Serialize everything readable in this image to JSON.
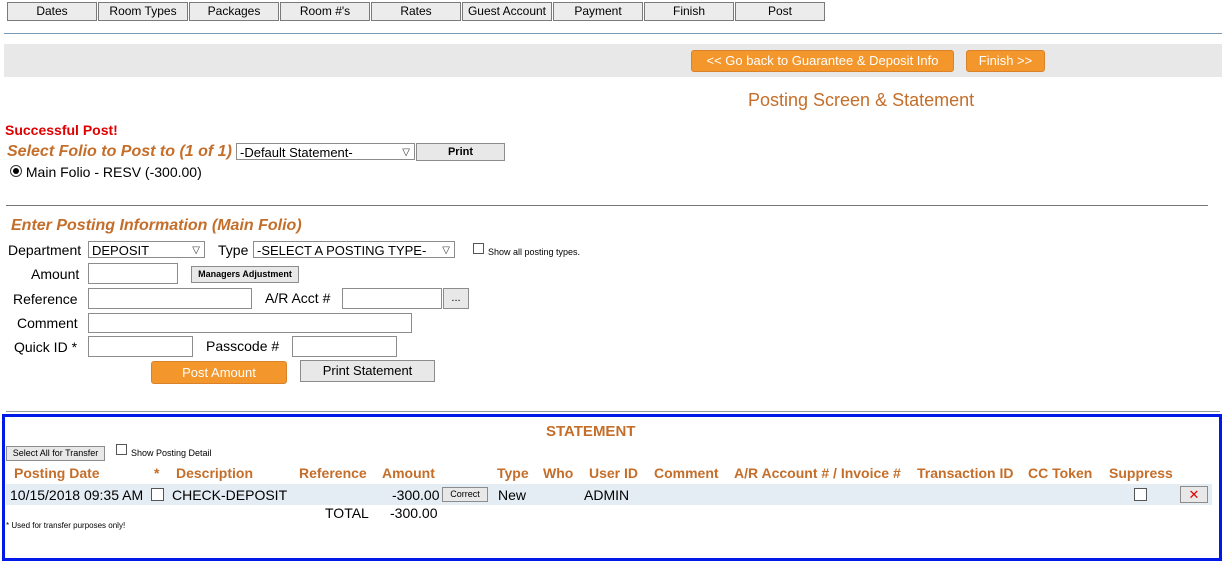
{
  "nav_tabs": [
    "Dates",
    "Room Types",
    "Packages",
    "Room #'s",
    "Rates",
    "Guest Account",
    "Payment",
    "Finish",
    "Post"
  ],
  "top_buttons": {
    "back": "<< Go back to Guarantee & Deposit Info",
    "finish": "Finish >>"
  },
  "page_title": "Posting Screen & Statement",
  "status_message": "Successful Post!",
  "folio": {
    "select_label": "Select Folio to Post to (1 of 1)",
    "statement_select": "-Default Statement-",
    "print_label": "Print",
    "radio_label": "Main Folio - RESV (-300.00)"
  },
  "posting": {
    "heading": "Enter Posting Information (Main Folio)",
    "department_label": "Department",
    "department_value": "DEPOSIT",
    "type_label": "Type",
    "type_value": "-SELECT A POSTING TYPE-",
    "show_all_label": "Show all posting types.",
    "amount_label": "Amount",
    "managers_adjustment": "Managers Adjustment",
    "reference_label": "Reference",
    "ar_acct_label": "A/R Acct #",
    "ellipsis": "...",
    "comment_label": "Comment",
    "quick_id_label": "Quick ID *",
    "passcode_label": "Passcode #",
    "post_amount": "Post Amount",
    "print_statement": "Print Statement"
  },
  "statement": {
    "title": "STATEMENT",
    "select_all": "Select All for Transfer",
    "show_detail": "Show Posting Detail",
    "columns": [
      "Posting Date",
      "*",
      "Description",
      "Reference",
      "Amount",
      "Type",
      "Who",
      "User ID",
      "Comment",
      "A/R Account # / Invoice #",
      "Transaction ID",
      "CC Token",
      "Suppress"
    ],
    "row": {
      "date": "10/15/2018 09:35 AM",
      "description": "CHECK-DEPOSIT",
      "amount": "-300.00",
      "correct": "Correct",
      "type": "New",
      "user_id": "ADMIN",
      "delete_icon": "✕"
    },
    "total_label": "TOTAL",
    "total_value": "-300.00",
    "footnote": "* Used for transfer purposes only!"
  },
  "colors": {
    "accent": "#c46e2a",
    "button_orange": "#f3962c",
    "alert": "#e00000",
    "statement_border": "#0018e8"
  }
}
